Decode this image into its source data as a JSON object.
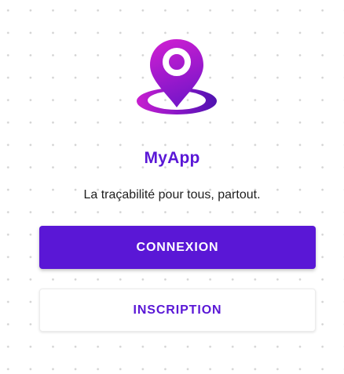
{
  "app": {
    "name": "MyApp",
    "tagline": "La traçabilité pour tous, partout.",
    "logo_icon": "location-pin-icon"
  },
  "actions": {
    "login_label": "CONNEXION",
    "signup_label": "INSCRIPTION"
  },
  "colors": {
    "accent": "#5a17d6",
    "logo_gradient_start": "#d21fd2",
    "logo_gradient_end": "#5c13b8"
  }
}
